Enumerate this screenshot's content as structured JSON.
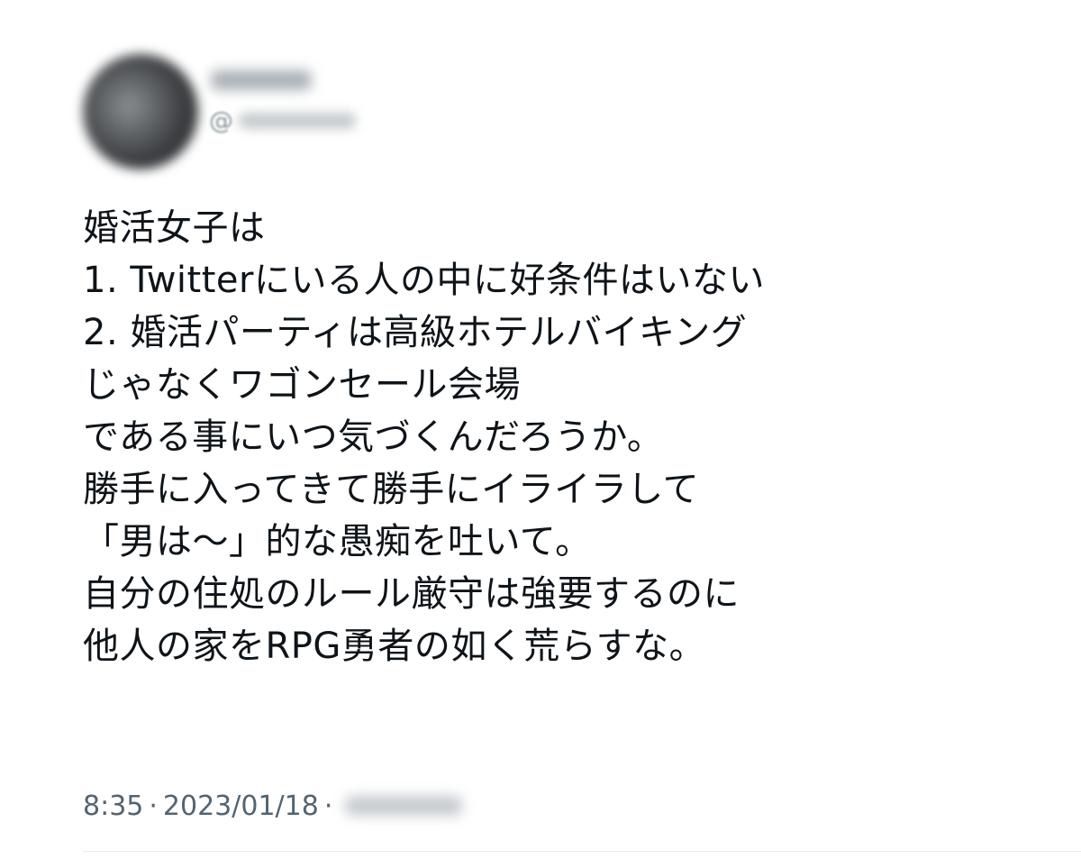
{
  "tweet": {
    "handle_prefix": "@",
    "body_lines": [
      "婚活女子は",
      "1. Twitterにいる人の中に好条件はいない",
      "2. 婚活パーティは高級ホテルバイキング",
      "じゃなくワゴンセール会場",
      "である事にいつ気づくんだろうか。",
      "勝手に入ってきて勝手にイライラして",
      "「男は〜」的な愚痴を吐いて。",
      "自分の住処のルール厳守は強要するのに",
      "他人の家をRPG勇者の如く荒らすな。"
    ],
    "time": "8:35",
    "separator": "·",
    "date": "2023/01/18"
  }
}
